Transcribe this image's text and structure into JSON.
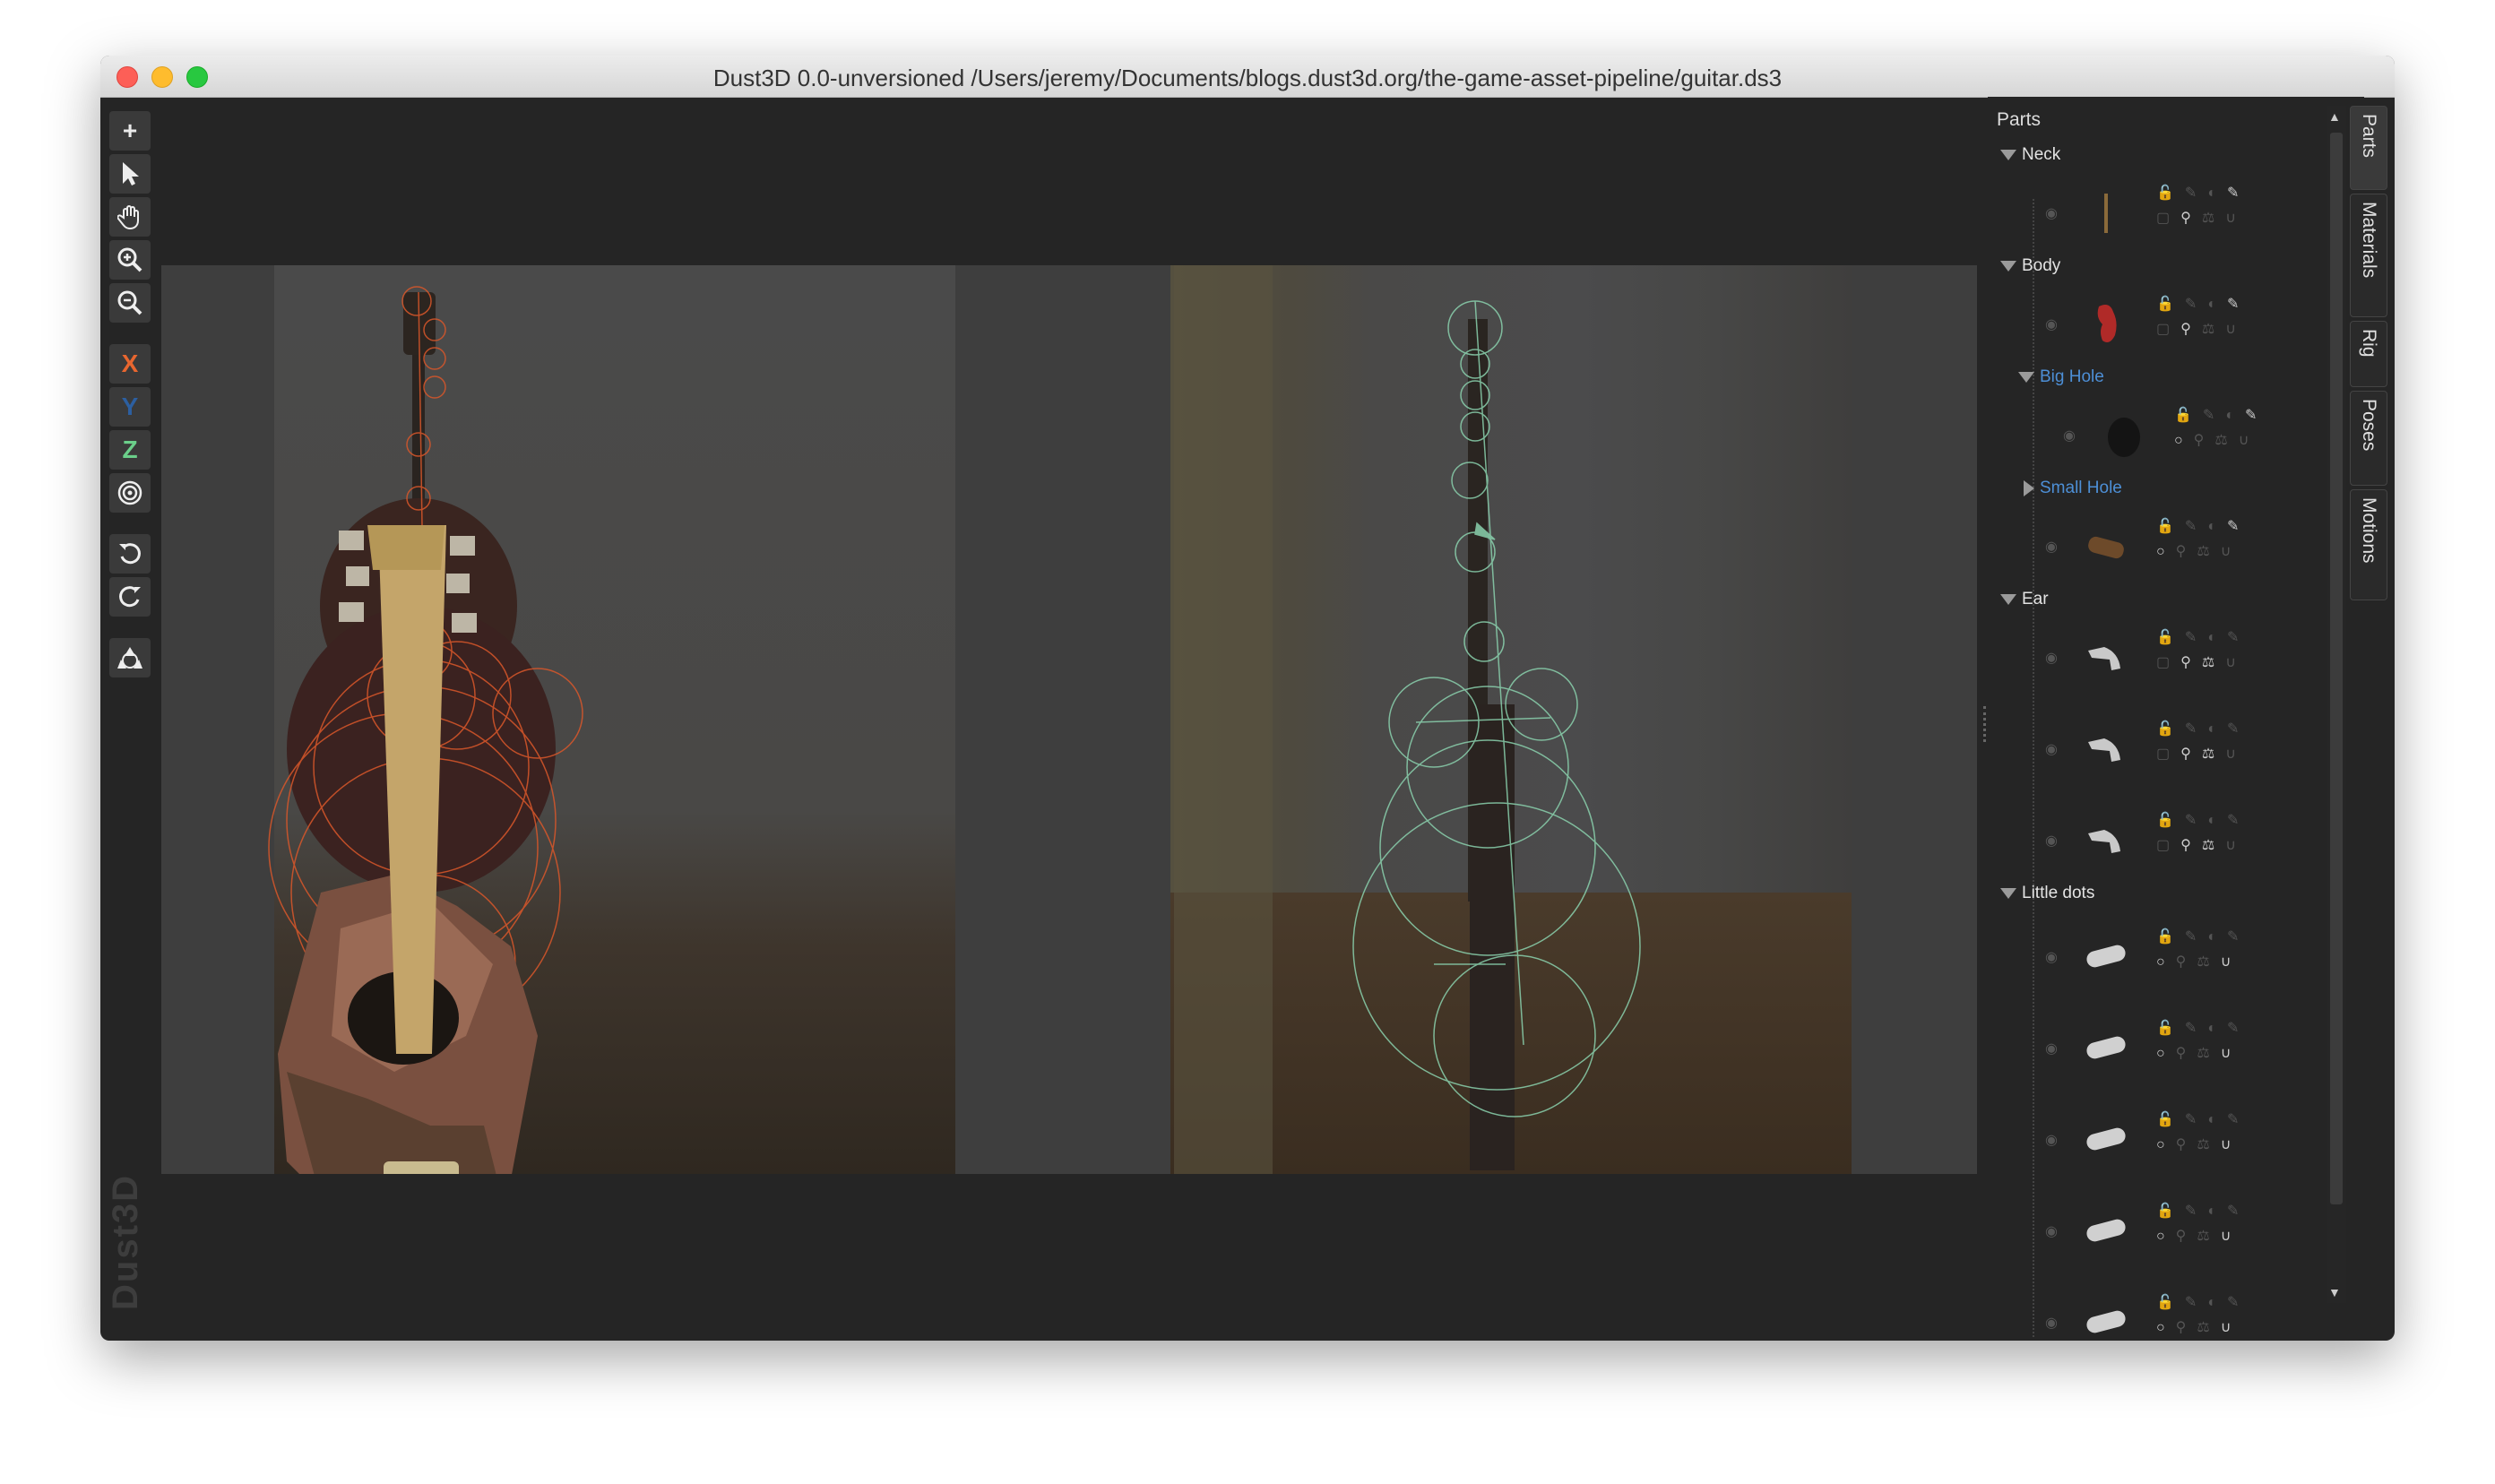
{
  "window": {
    "title": "Dust3D 0.0-unversioned /Users/jeremy/Documents/blogs.dust3d.org/the-game-asset-pipeline/guitar.ds3"
  },
  "toolbar": {
    "add": "+",
    "select": "select-arrow-icon",
    "pan": "hand-icon",
    "zoom_in": "zoom-in-icon",
    "zoom_out": "zoom-out-icon",
    "x_label": "X",
    "y_label": "Y",
    "z_label": "Z",
    "radial": "radial-target-icon",
    "undo": "undo-icon",
    "redo": "redo-icon",
    "recycle": "recycle-icon"
  },
  "colors": {
    "x_axis": "#e8662f",
    "y_axis": "#2c5fa0",
    "z_axis": "#6bcf8a",
    "front_profile": "#d9572a",
    "side_profile": "#8ad1ad",
    "sub_group": "#4d8fd6"
  },
  "watermark": "Dust3D",
  "parts_panel": {
    "title": "Parts",
    "groups": [
      {
        "name": "Neck",
        "expanded": true,
        "sub": false
      },
      {
        "name": "Body",
        "expanded": true,
        "sub": false
      },
      {
        "name": "Big Hole",
        "expanded": true,
        "sub": true
      },
      {
        "name": "Small Hole",
        "expanded": false,
        "sub": true
      },
      {
        "name": "Ear",
        "expanded": true,
        "sub": false
      },
      {
        "name": "Little dots",
        "expanded": true,
        "sub": false
      }
    ]
  },
  "side_tabs": [
    "Parts",
    "Materials",
    "Rig",
    "Poses",
    "Motions"
  ]
}
